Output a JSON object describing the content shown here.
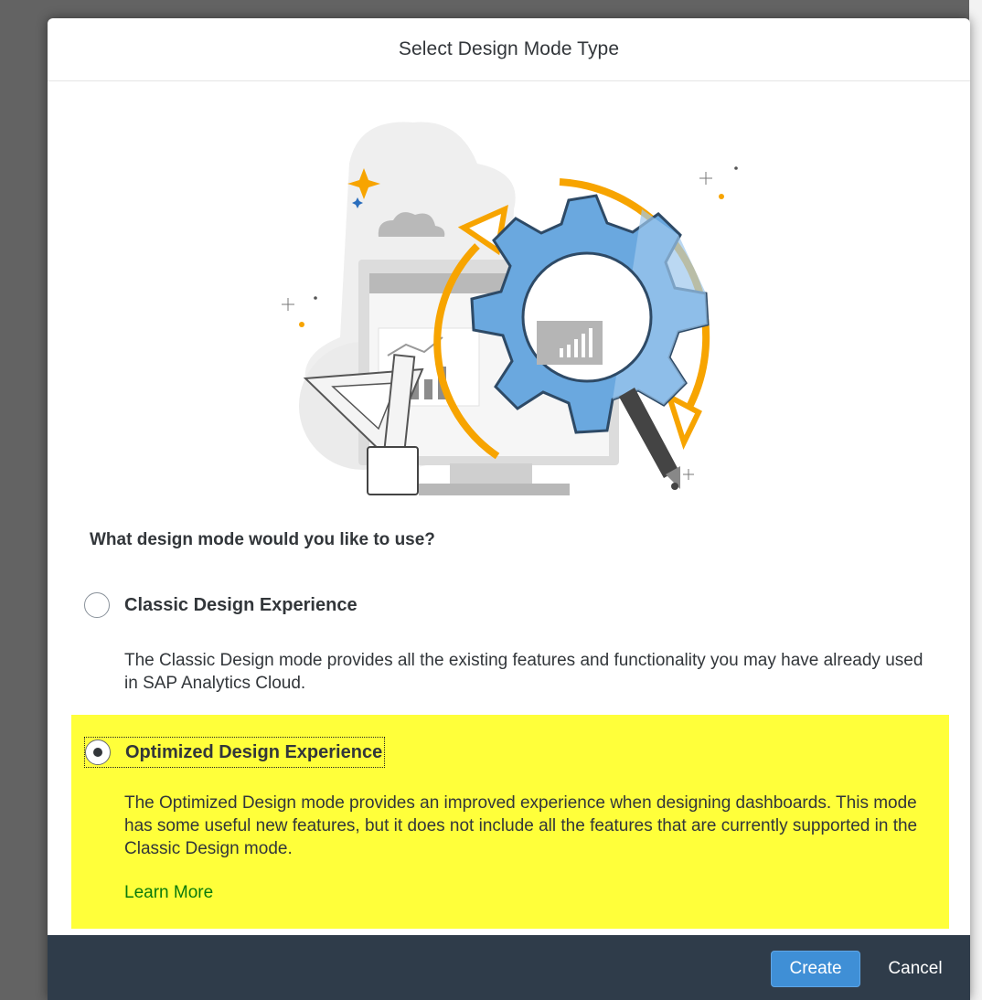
{
  "dialog": {
    "title": "Select Design Mode Type"
  },
  "question": "What design mode would you like to use?",
  "options": [
    {
      "label": "Classic Design Experience",
      "description": "The Classic Design mode provides all the existing features and functionality you may have already used in SAP Analytics Cloud.",
      "selected": false
    },
    {
      "label": "Optimized Design Experience",
      "description": "The Optimized Design mode provides an improved experience when designing dashboards. This mode has some useful new features, but it does not include all the features that are currently supported in the Classic Design mode.",
      "selected": true,
      "highlight_color": "#ffff3a",
      "learn_more": "Learn More"
    }
  ],
  "footer": {
    "create_label": "Create",
    "cancel_label": "Cancel"
  },
  "colors": {
    "accent": "#3f8fd6",
    "footer_bg": "#2f3c4a",
    "link": "#0b7a0b",
    "gear_blue": "#6aa8df",
    "arrow_orange": "#f7a400"
  }
}
